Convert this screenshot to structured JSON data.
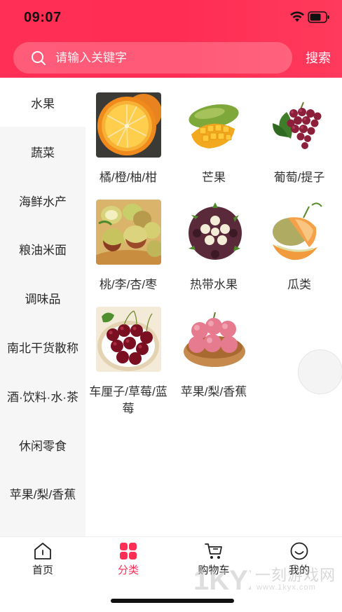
{
  "status_bar": {
    "time": "09:07"
  },
  "search": {
    "placeholder": "请输入关键字",
    "button_label": "搜索"
  },
  "sidebar": {
    "items": [
      {
        "label": "水果",
        "active": true
      },
      {
        "label": "蔬菜"
      },
      {
        "label": "海鲜水产"
      },
      {
        "label": "粮油米面"
      },
      {
        "label": "调味品"
      },
      {
        "label": "南北干货散称"
      },
      {
        "label": "酒·饮料·水·茶"
      },
      {
        "label": "休闲零食"
      },
      {
        "label": "苹果/梨/香蕉"
      }
    ]
  },
  "grid": {
    "items": [
      {
        "label": "橘/橙/柚/柑",
        "image": "orange"
      },
      {
        "label": "芒果",
        "image": "mango"
      },
      {
        "label": "葡萄/提子",
        "image": "grape"
      },
      {
        "label": "桃/李/杏/枣",
        "image": "jujube"
      },
      {
        "label": "热带水果",
        "image": "mangosteen"
      },
      {
        "label": "瓜类",
        "image": "melon"
      },
      {
        "label": "车厘子/草莓/蓝莓",
        "image": "cherry"
      },
      {
        "label": "苹果/梨/香蕉",
        "image": "apple"
      }
    ]
  },
  "tabbar": {
    "tabs": [
      {
        "label": "首页",
        "icon": "home-icon"
      },
      {
        "label": "分类",
        "icon": "category-icon",
        "active": true
      },
      {
        "label": "购物车",
        "icon": "cart-icon"
      },
      {
        "label": "我的",
        "icon": "profile-icon"
      }
    ]
  },
  "watermark": {
    "text": "一刻游戏网",
    "url": "www.1kyx.com",
    "logo_text": "1KYX"
  },
  "colors": {
    "accent": "#ff2e55",
    "sidebar_bg": "#f6f6f6",
    "text": "#333333"
  }
}
